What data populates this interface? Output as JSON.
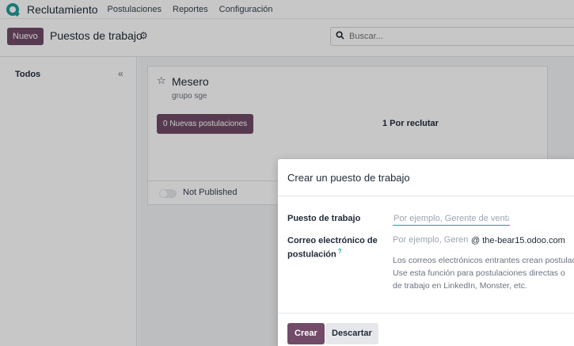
{
  "navbar": {
    "app_name": "Reclutamiento",
    "menu": [
      "Postulaciones",
      "Reportes",
      "Configuración"
    ]
  },
  "control_panel": {
    "new_button": "Nuevo",
    "title": "Puestos de trabajo",
    "search_placeholder": "Buscar..."
  },
  "sidebar": {
    "title": "Todos"
  },
  "card": {
    "title": "Mesero",
    "company": "grupo sge",
    "applications_button": "0 Nuevas postulaciones",
    "to_recruit": "1 Por reclutar",
    "publish_status": "Not Published"
  },
  "modal": {
    "title": "Crear un puesto de trabajo",
    "job_label": "Puesto de trabajo",
    "job_placeholder": "Por ejemplo, Gerente de ventas",
    "email_label": "Correo electrónico de postulación",
    "email_help_mark": "?",
    "email_placeholder": "Por ejemplo, Gerente de ventas",
    "email_domain": "@ the-bear15.odoo.com",
    "help_lines": [
      "Los correos electrónicos entrantes crean postulaciones",
      "Use esta función para postulaciones directas o",
      "de trabajo en LinkedIn, Monster, etc."
    ],
    "create_button": "Crear",
    "discard_button": "Descartar"
  },
  "colors": {
    "primary": "#714b67",
    "accent": "#1f9c9a"
  }
}
